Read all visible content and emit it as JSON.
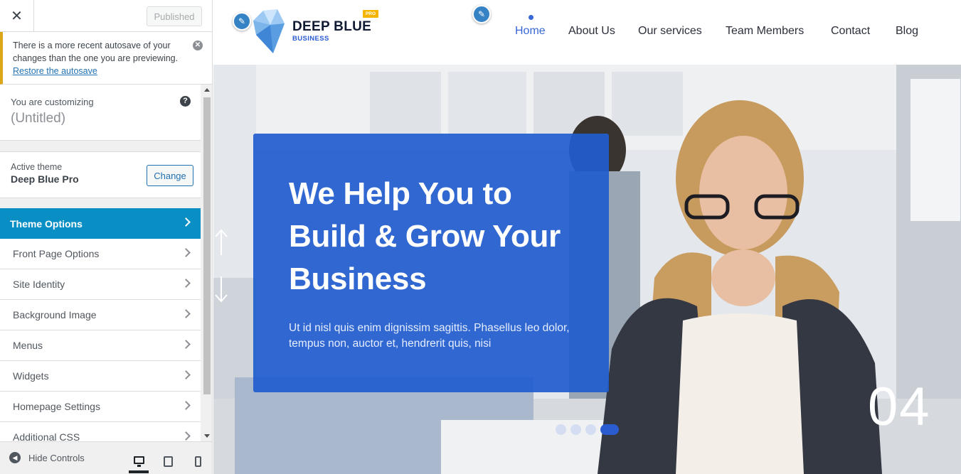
{
  "customizer": {
    "close_icon": "close-icon",
    "publish_label": "Published",
    "notice": {
      "text": "There is a more recent autosave of your changes than the one you are previewing.",
      "link": "Restore the autosave"
    },
    "customizing_label": "You are customizing",
    "site_title": "(Untitled)",
    "active_theme_label": "Active theme",
    "theme_name": "Deep Blue Pro",
    "change_label": "Change",
    "menu": [
      {
        "label": "Theme Options",
        "active": true
      },
      {
        "label": "Front Page Options"
      },
      {
        "label": "Site Identity"
      },
      {
        "label": "Background Image"
      },
      {
        "label": "Menus"
      },
      {
        "label": "Widgets"
      },
      {
        "label": "Homepage Settings"
      },
      {
        "label": "Additional CSS"
      }
    ],
    "hide_controls_label": "Hide Controls",
    "devices": [
      "desktop",
      "tablet",
      "mobile"
    ]
  },
  "site": {
    "brand": "DEEP BLUE",
    "brand_sub": "BUSINESS",
    "pro_badge": "PRO",
    "nav": [
      "Home",
      "About Us",
      "Our services",
      "Team Members",
      "Contact",
      "Blog"
    ],
    "active_nav": "Home",
    "hero": {
      "title_lines": [
        "We Help You to",
        "Build & Grow Your",
        "Business"
      ],
      "subtitle": "Ut id nisl quis enim dignissim sagittis. Phasellus leo dolor, tempus non, auctor et, hendrerit quis, nisi",
      "slide_number": "04",
      "active_dot": 4
    }
  },
  "colors": {
    "accent": "#0a8fc5",
    "hero_card": "#215cce",
    "nav_active": "#3867d6",
    "notice_border": "#dba617"
  }
}
